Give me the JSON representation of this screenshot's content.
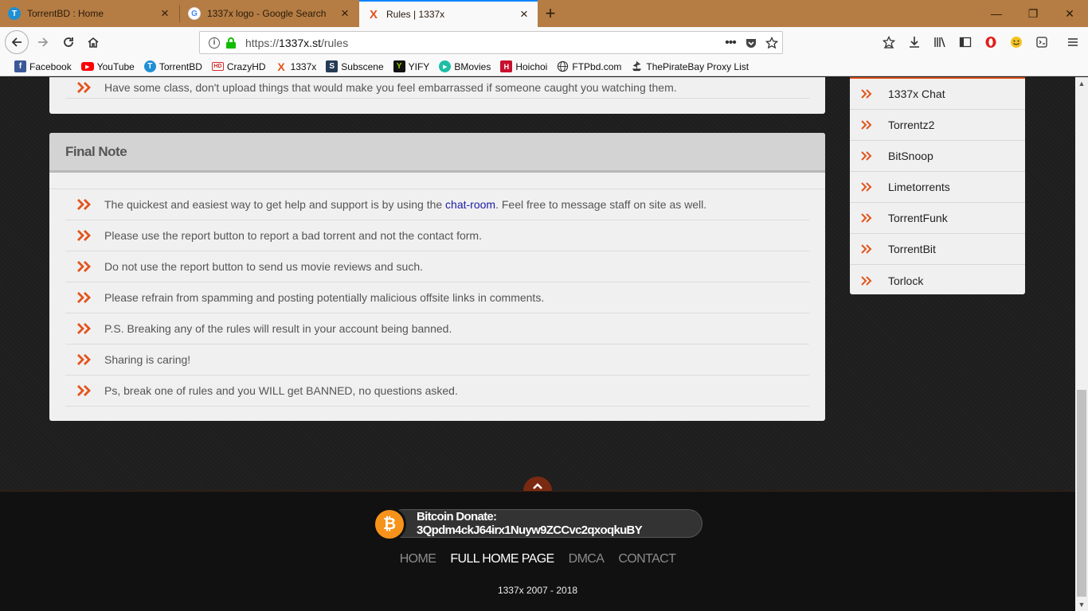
{
  "tabs": [
    {
      "title": "TorrentBD : Home",
      "favicon": "torrentbd-icon",
      "active": false
    },
    {
      "title": "1337x logo - Google Search",
      "favicon": "google-icon",
      "active": false
    },
    {
      "title": "Rules | 1337x",
      "favicon": "1337x-icon",
      "active": true
    }
  ],
  "window_controls": {
    "minimize": "—",
    "restore": "❐",
    "close": "✕"
  },
  "address_bar": {
    "url_prefix": "https://",
    "url_domain": "1337x.st",
    "url_path": "/rules"
  },
  "bookmarks": [
    {
      "label": "Facebook",
      "icon": "facebook-icon",
      "color": "#3b5998"
    },
    {
      "label": "YouTube",
      "icon": "youtube-icon",
      "color": "#ff0000"
    },
    {
      "label": "TorrentBD",
      "icon": "torrentbd-icon",
      "color": "#1f8fd6"
    },
    {
      "label": "CrazyHD",
      "icon": "crazyhd-icon",
      "color": "#d42b2b"
    },
    {
      "label": "1337x",
      "icon": "1337x-icon",
      "color": "#e2541b"
    },
    {
      "label": "Subscene",
      "icon": "subscene-icon",
      "color": "#243b55"
    },
    {
      "label": "YIFY",
      "icon": "yify-icon",
      "color": "#2a2a2a"
    },
    {
      "label": "BMovies",
      "icon": "bmovies-icon",
      "color": "#1cbfa4"
    },
    {
      "label": "Hoichoi",
      "icon": "hoichoi-icon",
      "color": "#c8102e"
    },
    {
      "label": "FTPbd.com",
      "icon": "globe-icon",
      "color": "#333333"
    },
    {
      "label": "ThePirateBay Proxy List",
      "icon": "pirate-ship-icon",
      "color": "#333333"
    }
  ],
  "top_rule": {
    "text": "Have some class, don't upload things that would make you feel embarrassed if someone caught you watching them."
  },
  "final_note": {
    "title": "Final Note",
    "rules": [
      {
        "before": "The quickest and easiest way to get help and support is by using the ",
        "link": "chat-room",
        "after": ". Feel free to message staff on site as well."
      },
      {
        "before": "Please use the report button to report a bad torrent and not the contact form.",
        "link": "",
        "after": ""
      },
      {
        "before": "Do not use the report button to send us movie reviews and such.",
        "link": "",
        "after": ""
      },
      {
        "before": "Please refrain from spamming and posting potentially malicious offsite links in comments.",
        "link": "",
        "after": ""
      },
      {
        "before": "P.S. Breaking any of the rules will result in your account being banned.",
        "link": "",
        "after": ""
      },
      {
        "before": "Sharing is caring!",
        "link": "",
        "after": ""
      },
      {
        "before": "Ps, break one of rules and you WILL get BANNED, no questions asked.",
        "link": "",
        "after": ""
      }
    ]
  },
  "sidebar": {
    "items": [
      {
        "label": "1337x Chat"
      },
      {
        "label": "Torrentz2"
      },
      {
        "label": "BitSnoop"
      },
      {
        "label": "Limetorrents"
      },
      {
        "label": "TorrentFunk"
      },
      {
        "label": "TorrentBit"
      },
      {
        "label": "Torlock"
      }
    ]
  },
  "footer": {
    "bitcoin_label": "Bitcoin Donate: 3Qpdm4ckJ64irx1Nuyw9ZCCvc2qxoqkuBY",
    "bitcoin_symbol": "₿",
    "nav": [
      {
        "label": "HOME",
        "current": false
      },
      {
        "label": "FULL HOME PAGE",
        "current": true
      },
      {
        "label": "DMCA",
        "current": false
      },
      {
        "label": "CONTACT",
        "current": false
      }
    ],
    "copyright": "1337x 2007 - 2018"
  },
  "colors": {
    "accent": "#e2541b",
    "tab_strip": "#b57d44",
    "link": "#1b1ba8",
    "bitcoin": "#f7931a"
  }
}
